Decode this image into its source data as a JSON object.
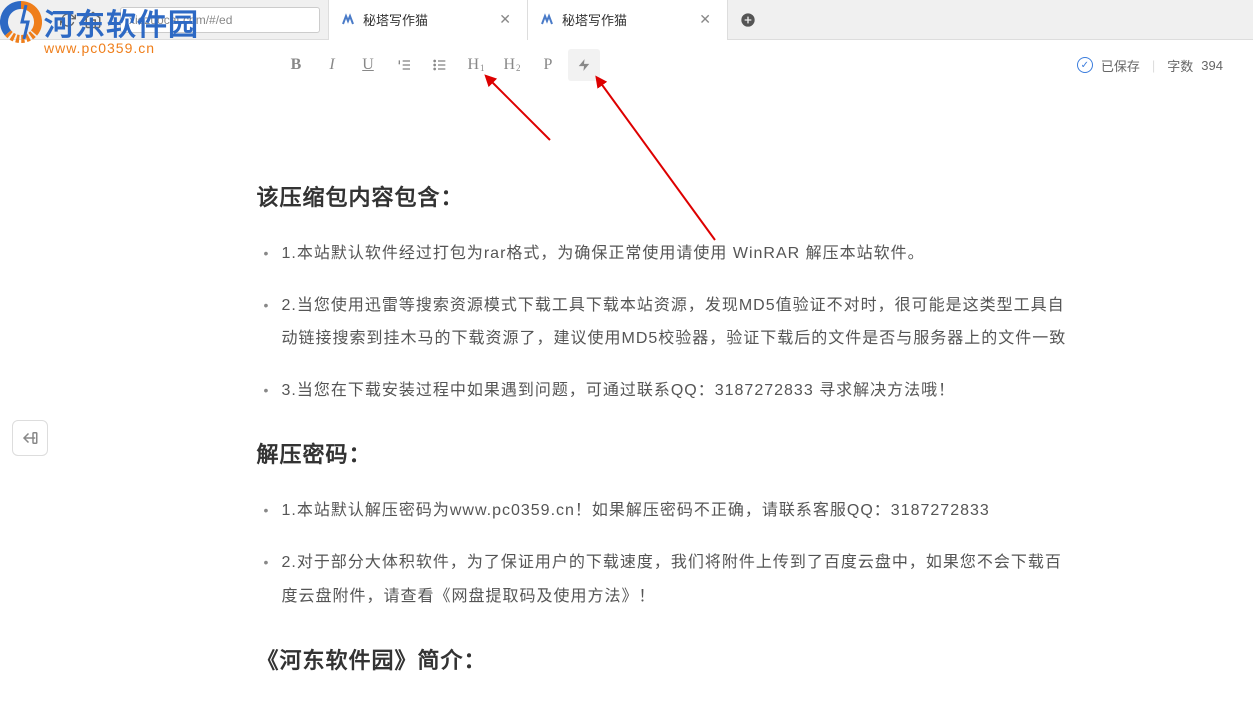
{
  "browser": {
    "url": "xiezuocat.com/#/ed",
    "tabs": [
      {
        "title": "秘塔写作猫"
      },
      {
        "title": "秘塔写作猫"
      }
    ]
  },
  "watermark": {
    "title": "河东软件园",
    "url": "www.pc0359.cn"
  },
  "toolbar": {
    "bold": "B",
    "italic": "I",
    "underline": "U",
    "h1_main": "H",
    "h1_sub": "1",
    "h2_main": "H",
    "h2_sub": "2",
    "paragraph": "P",
    "saved": "已保存",
    "word_count_label": "字数",
    "word_count": "394"
  },
  "document": {
    "heading1": "该压缩包内容包含：",
    "list1": [
      {
        "num": "1.",
        "text": "本站默认软件经过打包为rar格式，为确保正常使用请使用 WinRAR 解压本站软件。"
      },
      {
        "num": "2.",
        "text": "当您使用迅雷等搜索资源模式下载工具下载本站资源，发现MD5值验证不对时，很可能是这类型工具自动链接搜索到挂木马的下载资源了，建议使用MD5校验器，验证下载后的文件是否与服务器上的文件一致"
      },
      {
        "num": "3.",
        "text": "当您在下载安装过程中如果遇到问题，可通过联系QQ：3187272833 寻求解决方法哦！"
      }
    ],
    "heading2": "解压密码：",
    "list2": [
      {
        "num": "1.",
        "text": "本站默认解压密码为www.pc0359.cn！如果解压密码不正确，请联系客服QQ：3187272833"
      },
      {
        "num": "2.",
        "text": "对于部分大体积软件，为了保证用户的下载速度，我们将附件上传到了百度云盘中，如果您不会下载百度云盘附件，请查看《网盘提取码及使用方法》！"
      }
    ],
    "heading3": "《河东软件园》简介："
  }
}
